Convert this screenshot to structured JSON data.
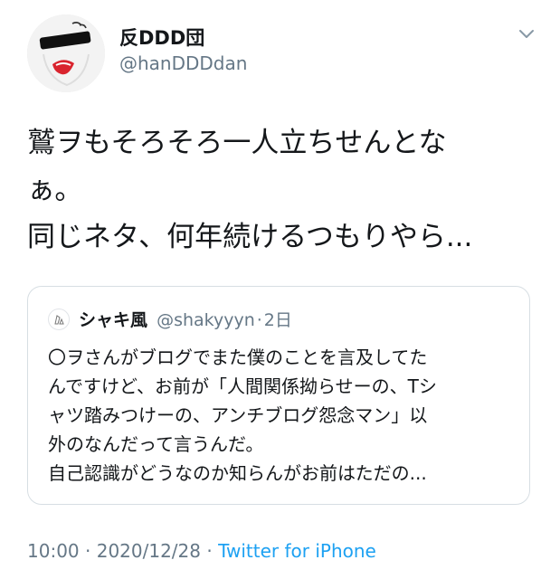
{
  "author": {
    "display_name": "反DDD団",
    "handle": "@hanDDDdan"
  },
  "tweet": {
    "lines": [
      "鷲ヲもそろそろ一人立ちせんとな",
      "ぁ。",
      "同じネタ、何年続けるつもりやら..."
    ]
  },
  "quoted_tweet": {
    "display_name": "シャキ風",
    "handle": "@shakyyyn",
    "separator": "·",
    "time_ago": "2日",
    "lines": [
      "〇ヲさんがブログでまた僕のことを言及してた",
      "んですけど、お前が「人間関係拗らせーの、Tシ",
      "ャツ踏みつけーの、アンチブログ怨念マン」以",
      "外のなんだって言うんだ。",
      "自己認識がどうなのか知らんがお前はただの..."
    ]
  },
  "meta": {
    "time": "10:00",
    "separator": "·",
    "date": "2020/12/28",
    "source": "Twitter for iPhone"
  },
  "icons": {
    "menu": "chevron-down-icon",
    "avatar": "avatar",
    "quoted_avatar": "avatar"
  },
  "colors": {
    "accent": "#1da1f2",
    "secondary_text": "#657786",
    "primary_text": "#14171a",
    "border": "#d7dee3"
  }
}
